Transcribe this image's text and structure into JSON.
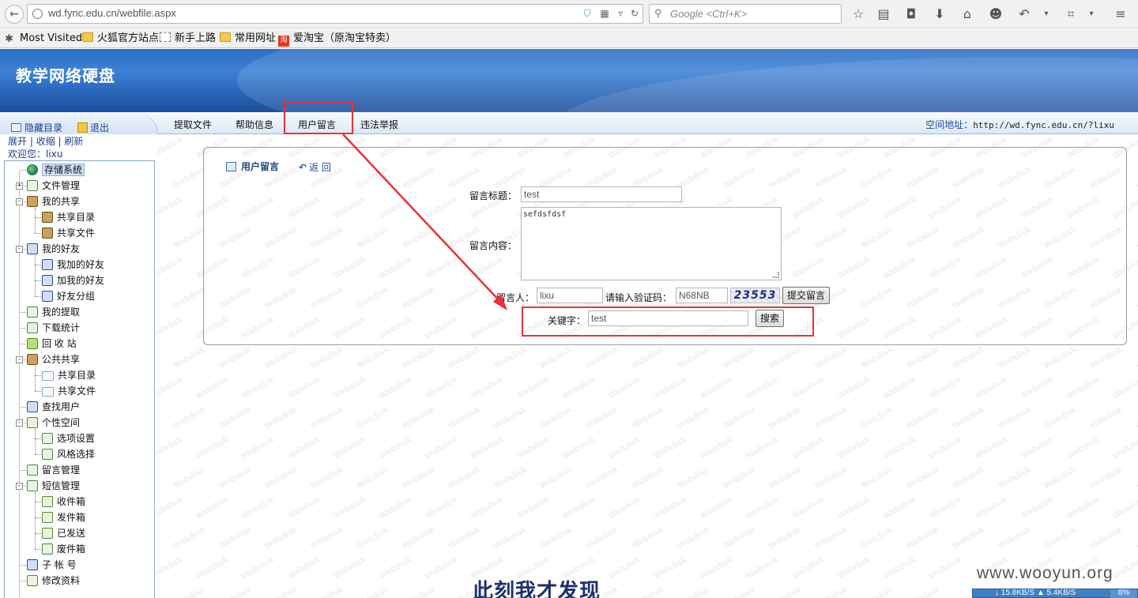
{
  "browser": {
    "url": "wd.fync.edu.cn/webfile.aspx",
    "search_placeholder": "Google <Ctrl+K>",
    "bookmarks": [
      {
        "label": "Most Visited",
        "icon": "star-icon"
      },
      {
        "label": "火狐官方站点",
        "icon": "folder-icon"
      },
      {
        "label": "新手上路",
        "icon": "page-icon"
      },
      {
        "label": "常用网址",
        "icon": "folder-icon"
      },
      {
        "label": "爱淘宝（原淘宝特卖）",
        "icon": "taobao-icon"
      }
    ],
    "taobao_glyph": "淘"
  },
  "header": {
    "site_title": "教学网络硬盘"
  },
  "nav": {
    "items": [
      "提取文件",
      "帮助信息",
      "用户留言",
      "违法举报"
    ],
    "space_label": "空间地址：",
    "space_url": "http://wd.fync.edu.cn/?lixu"
  },
  "sidebar": {
    "hide_dir": "隐藏目录",
    "exit": "退出",
    "expand": "展开",
    "collapse": "收缩",
    "refresh": "刷新",
    "sep": " | ",
    "welcome": "欢迎您：lixu",
    "tree": [
      {
        "label": "存储系统",
        "level": 0,
        "icon": "globe",
        "selected": true
      },
      {
        "label": "文件管理",
        "level": 1,
        "icon": "doc",
        "expander": "+"
      },
      {
        "label": "我的共享",
        "level": 1,
        "icon": "share",
        "expander": "-"
      },
      {
        "label": "共享目录",
        "level": 2,
        "icon": "share"
      },
      {
        "label": "共享文件",
        "level": 2,
        "icon": "share"
      },
      {
        "label": "我的好友",
        "level": 1,
        "icon": "friend",
        "expander": "-"
      },
      {
        "label": "我加的好友",
        "level": 2,
        "icon": "friend"
      },
      {
        "label": "加我的好友",
        "level": 2,
        "icon": "friend"
      },
      {
        "label": "好友分组",
        "level": 2,
        "icon": "friend"
      },
      {
        "label": "我的提取",
        "level": 1,
        "icon": "doc"
      },
      {
        "label": "下载统计",
        "level": 1,
        "icon": "doc"
      },
      {
        "label": "回 收 站",
        "level": 1,
        "icon": "recycle"
      },
      {
        "label": "公共共享",
        "level": 1,
        "icon": "share",
        "expander": "-"
      },
      {
        "label": "共享目录",
        "level": 2,
        "icon": "folder"
      },
      {
        "label": "共享文件",
        "level": 2,
        "icon": "folder"
      },
      {
        "label": "查找用户",
        "level": 1,
        "icon": "friend"
      },
      {
        "label": "个性空间",
        "level": 1,
        "icon": "doc",
        "expander": "-"
      },
      {
        "label": "选项设置",
        "level": 2,
        "icon": "doc"
      },
      {
        "label": "风格选择",
        "level": 2,
        "icon": "doc"
      },
      {
        "label": "留言管理",
        "level": 1,
        "icon": "doc"
      },
      {
        "label": "短信管理",
        "level": 1,
        "icon": "doc",
        "expander": "-"
      },
      {
        "label": "收件箱",
        "level": 2,
        "icon": "doc"
      },
      {
        "label": "发件箱",
        "level": 2,
        "icon": "doc"
      },
      {
        "label": "已发送",
        "level": 2,
        "icon": "doc"
      },
      {
        "label": "废件箱",
        "level": 2,
        "icon": "doc"
      },
      {
        "label": "子 帐 号",
        "level": 1,
        "icon": "friend"
      },
      {
        "label": "修改资料",
        "level": 1,
        "icon": "doc"
      }
    ]
  },
  "panel": {
    "title": "用户留言",
    "back": "返 回",
    "subject_label": "留言标题：",
    "subject_value": "test",
    "content_label": "留言内容：",
    "content_value": "sefdsfdsf",
    "author_label": "留言人：",
    "author_value": "lixu",
    "captcha_label": "请输入验证码：",
    "captcha_value": "N68NB",
    "captcha_image_text": "23553",
    "submit_label": "提交留言",
    "keyword_label": "关键字：",
    "keyword_value": "test",
    "search_label": "搜索"
  },
  "watermark_text": "Webdisk",
  "overlay": {
    "bottom_text": "此刻我才发现",
    "site_mark": "www.wooyun.org",
    "net_down": "15.8KB/S",
    "net_up": "5.4KB/S",
    "net_pct": "8%"
  },
  "colors": {
    "banner": "#2b6cc4",
    "highlight_red": "#e8333a",
    "link_blue": "#1f3f8f"
  }
}
